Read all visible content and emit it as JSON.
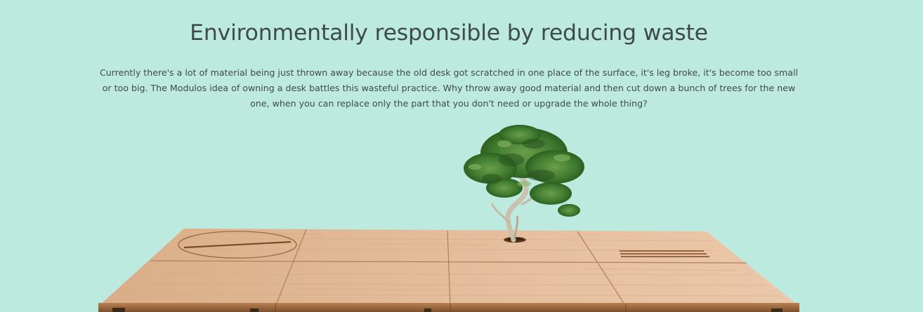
{
  "colors": {
    "background": "#bdeadf",
    "text": "#3f4a4d",
    "wood_light": "#e2bb98",
    "wood_edge": "#8a5a32",
    "leaf": "#3f7a30"
  },
  "section": {
    "heading": "Environmentally responsible by reducing waste",
    "paragraph": "Currently there's a lot of material being just thrown away because the old desk got scratched in one place of the surface, it's leg broke, it's become too small or too big. The Modulos idea of owning a desk battles this wasteful practice. Why throw away good material and then cut down a bunch of trees for the new one, when you can replace only the part that you don't need or upgrade the whole thing?"
  },
  "image": {
    "icon": "modular-desk-with-tree-image"
  }
}
